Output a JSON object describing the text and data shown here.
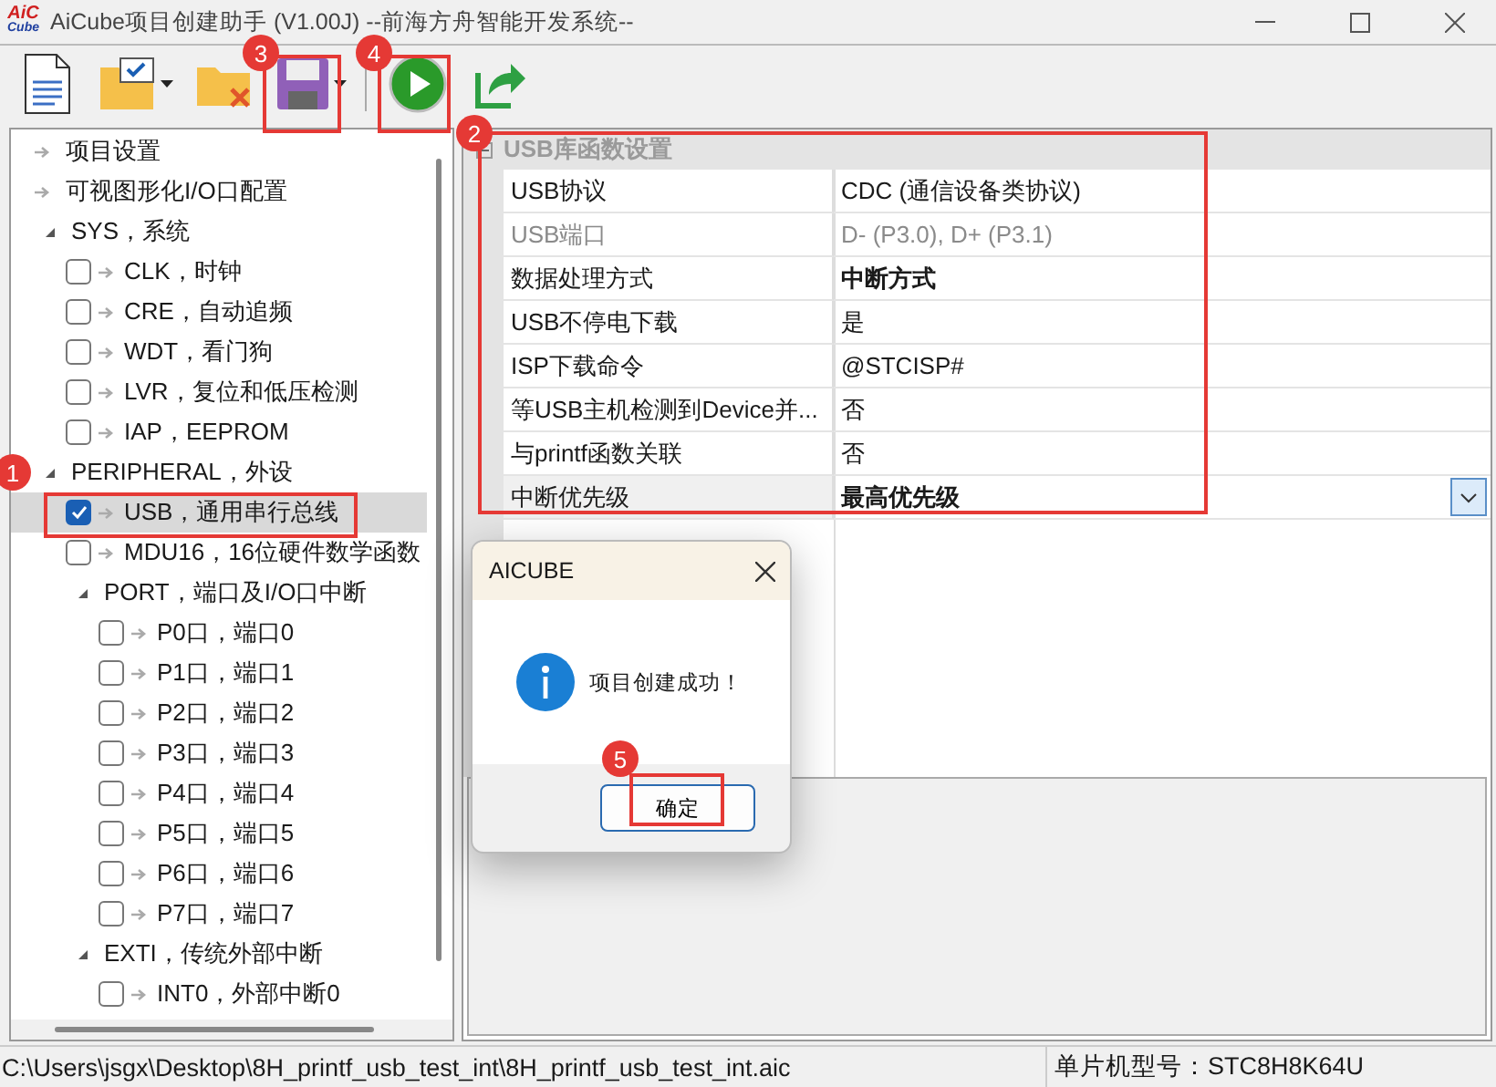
{
  "window": {
    "logo": [
      "AiC",
      "Cube"
    ],
    "title": "AiCube项目创建助手 (V1.00J) --前海方舟智能开发系统--"
  },
  "toolbar": [
    {
      "kind": "new",
      "dropdown": false
    },
    {
      "kind": "open",
      "dropdown": true
    },
    {
      "kind": "close",
      "dropdown": false
    },
    {
      "kind": "save",
      "dropdown": true
    },
    {
      "kind": "run",
      "dropdown": false
    },
    {
      "kind": "export",
      "dropdown": false
    }
  ],
  "tree": [
    {
      "kind": "link",
      "label": "项目设置"
    },
    {
      "kind": "link",
      "label": "可视图形化I/O口配置"
    },
    {
      "kind": "group",
      "label": "SYS，系统",
      "expanded": true,
      "children": [
        {
          "kind": "check",
          "label": "CLK，时钟",
          "checked": false,
          "selected": false
        },
        {
          "kind": "check",
          "label": "CRE，自动追频",
          "checked": false,
          "selected": false
        },
        {
          "kind": "check",
          "label": "WDT，看门狗",
          "checked": false,
          "selected": false
        },
        {
          "kind": "check",
          "label": "LVR，复位和低压检测",
          "checked": false,
          "selected": false
        },
        {
          "kind": "check",
          "label": "IAP，EEPROM",
          "checked": false,
          "selected": false
        }
      ]
    },
    {
      "kind": "group",
      "label": "PERIPHERAL，外设",
      "expanded": true,
      "children": [
        {
          "kind": "check",
          "label": "USB，通用串行总线",
          "checked": true,
          "selected": true
        },
        {
          "kind": "check",
          "label": "MDU16，16位硬件数学函数",
          "checked": false,
          "selected": false
        },
        {
          "kind": "group",
          "label": "PORT，端口及I/O口中断",
          "expanded": true,
          "children": [
            {
              "kind": "check",
              "label": "P0口，端口0",
              "checked": false,
              "selected": false
            },
            {
              "kind": "check",
              "label": "P1口，端口1",
              "checked": false,
              "selected": false
            },
            {
              "kind": "check",
              "label": "P2口，端口2",
              "checked": false,
              "selected": false
            },
            {
              "kind": "check",
              "label": "P3口，端口3",
              "checked": false,
              "selected": false
            },
            {
              "kind": "check",
              "label": "P4口，端口4",
              "checked": false,
              "selected": false
            },
            {
              "kind": "check",
              "label": "P5口，端口5",
              "checked": false,
              "selected": false
            },
            {
              "kind": "check",
              "label": "P6口，端口6",
              "checked": false,
              "selected": false
            },
            {
              "kind": "check",
              "label": "P7口，端口7",
              "checked": false,
              "selected": false
            }
          ]
        },
        {
          "kind": "group",
          "label": "EXTI，传统外部中断",
          "expanded": true,
          "children": [
            {
              "kind": "check",
              "label": "INT0，外部中断0",
              "checked": false,
              "selected": false
            }
          ]
        }
      ]
    }
  ],
  "properties": {
    "category": "USB库函数设置",
    "expanded": true,
    "rows": [
      {
        "name": "USB协议",
        "value": "CDC (通信设备类协议)",
        "disabled": false,
        "modified": false,
        "selected": false
      },
      {
        "name": "USB端口",
        "value": "D- (P3.0), D+ (P3.1)",
        "disabled": true,
        "modified": false,
        "selected": false
      },
      {
        "name": "数据处理方式",
        "value": "中断方式",
        "disabled": false,
        "modified": true,
        "selected": false
      },
      {
        "name": "USB不停电下载",
        "value": "是",
        "disabled": false,
        "modified": false,
        "selected": false
      },
      {
        "name": "ISP下载命令",
        "value": "@STCISP#",
        "disabled": false,
        "modified": false,
        "selected": false
      },
      {
        "name": "等USB主机检测到Device并...",
        "value": "否",
        "disabled": false,
        "modified": false,
        "selected": false
      },
      {
        "name": "与printf函数关联",
        "value": "否",
        "disabled": false,
        "modified": false,
        "selected": false
      },
      {
        "name": "中断优先级",
        "value": "最高优先级",
        "disabled": false,
        "modified": true,
        "selected": true
      }
    ]
  },
  "dialog": {
    "title": "AICUBE",
    "message": "项目创建成功！",
    "button": "确定"
  },
  "status_bar": {
    "path": "C:\\Users\\jsgx\\Desktop\\8H_printf_usb_test_int\\8H_printf_usb_test_int.aic",
    "chip": "单片机型号：STC8H8K64U"
  },
  "annotations": [
    {
      "number": "1"
    },
    {
      "number": "2"
    },
    {
      "number": "3"
    },
    {
      "number": "4"
    },
    {
      "number": "5"
    }
  ]
}
